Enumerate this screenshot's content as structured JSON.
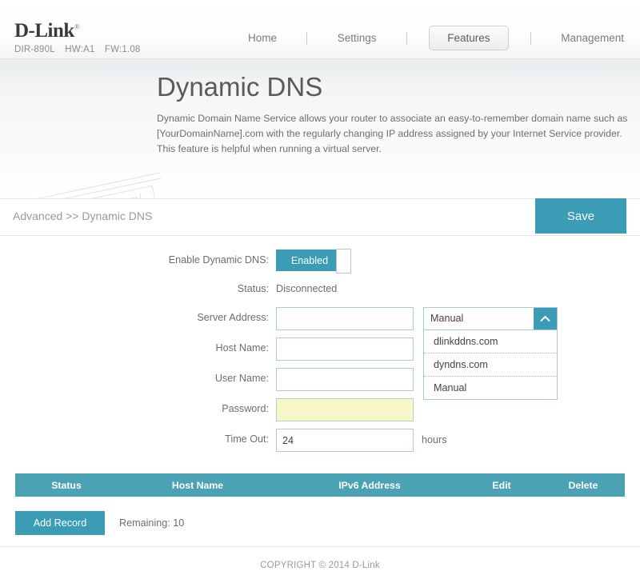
{
  "header": {
    "brand": "D-Link",
    "registered_mark": "®",
    "model": "DIR-890L",
    "hardware": "HW:A1",
    "firmware": "FW:1.08",
    "nav": [
      {
        "label": "Home",
        "active": false
      },
      {
        "label": "Settings",
        "active": false
      },
      {
        "label": "Features",
        "active": true
      },
      {
        "label": "Management",
        "active": false
      }
    ]
  },
  "hero": {
    "title": "Dynamic DNS",
    "description": "Dynamic Domain Name Service allows your router to associate an easy-to-remember domain name such as [YourDomainName].com with the regularly changing IP address assigned by your Internet Service provider. This feature is helpful when running a virtual server.",
    "watermark_text": "http://Betty.dlink.com/"
  },
  "breadcrumb": {
    "text": "Advanced >> Dynamic DNS",
    "save_label": "Save"
  },
  "form": {
    "enable_label": "Enable Dynamic DNS:",
    "enable_value": "Enabled",
    "status_label": "Status:",
    "status_value": "Disconnected",
    "server_address_label": "Server Address:",
    "server_address_value": "",
    "host_name_label": "Host Name:",
    "host_name_value": "",
    "user_name_label": "User Name:",
    "user_name_value": "",
    "password_label": "Password:",
    "password_value": "",
    "time_out_label": "Time Out:",
    "time_out_value": "24",
    "time_out_unit": "hours",
    "server_dropdown": {
      "selected": "Manual",
      "expanded": true,
      "chevron": "chevron-up-icon",
      "options": [
        "dlinkddns.com",
        "dyndns.com",
        "Manual"
      ]
    }
  },
  "table": {
    "columns": [
      "Status",
      "Host Name",
      "IPv6 Address",
      "Edit",
      "Delete"
    ],
    "rows": [],
    "add_record_label": "Add Record",
    "remaining_text": "Remaining: 10"
  },
  "footer": {
    "copyright": "COPYRIGHT © 2014 D-Link"
  },
  "colors": {
    "accent_teal": "#3b9cb6",
    "table_header_teal": "#4ba2b5",
    "input_border": "#a8cdd8",
    "password_highlight": "#f7f7c8"
  }
}
